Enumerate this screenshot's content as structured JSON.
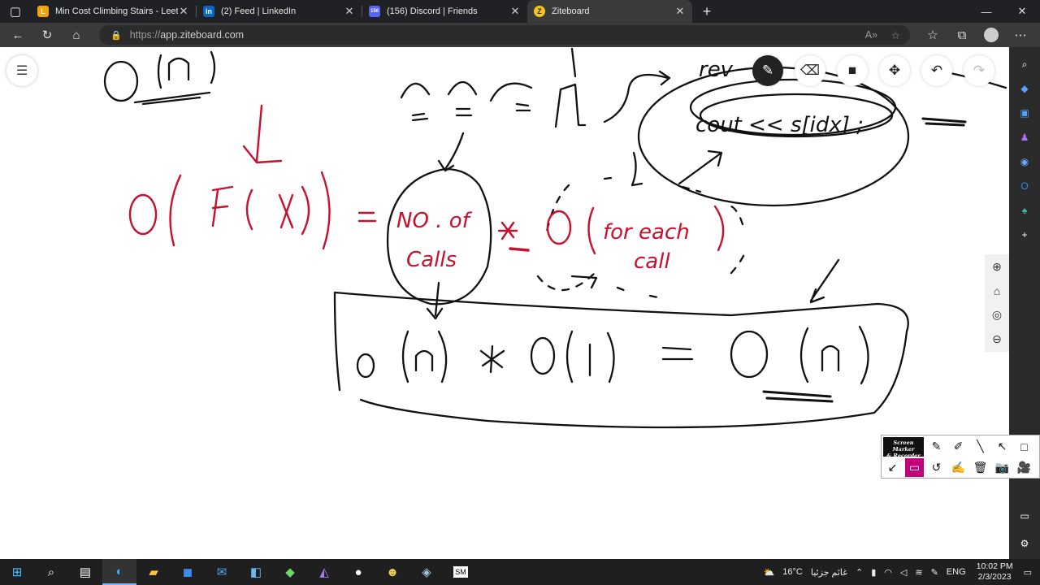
{
  "browser": {
    "tabs": [
      {
        "label": "Min Cost Climbing Stairs - LeetCo",
        "favicon": "leetcode-icon",
        "color": "#f0a30a",
        "glyph": "L"
      },
      {
        "label": "(2) Feed | LinkedIn",
        "favicon": "linkedin-icon",
        "color": "#0a66c2",
        "glyph": "in"
      },
      {
        "label": "(156) Discord | Friends",
        "favicon": "discord-icon",
        "color": "#5865f2",
        "glyph": "156"
      },
      {
        "label": "Ziteboard",
        "favicon": "ziteboard-icon",
        "color": "#f5c518",
        "glyph": "Z",
        "active": true
      }
    ],
    "new_tab": "+",
    "url_protocol": "https://",
    "url_host": "app.ziteboard.com"
  },
  "board": {
    "tools": [
      "pencil-icon",
      "eraser-icon",
      "sticky-note-icon",
      "move-icon",
      "undo-icon",
      "redo-icon"
    ],
    "zoom_controls": [
      "zoom-in-icon",
      "home-icon",
      "center-icon",
      "zoom-out-icon"
    ],
    "handwriting": {
      "top_left": "O(n)",
      "top_row": "⌐ = ⌐ = []",
      "bubble_top": "rev(s, idx) ; cout << s[idx] ; }",
      "formula_left": "O( F( X))",
      "equals": "=",
      "no_of_calls": "NO. of Calls",
      "times": "*",
      "per_call": "O( for each call)",
      "result_line": "O(n) * O(1) = O(n)"
    }
  },
  "screen_marker": {
    "logo_line1": "Screen Marker",
    "logo_line2": "& Recorder",
    "row1": [
      "pencil-icon",
      "marker-icon",
      "line-icon",
      "arrow-icon",
      "rectangle-icon"
    ],
    "row2": [
      "pointer-icon",
      "monitor-icon",
      "history-icon",
      "highlighter-icon",
      "trash-icon",
      "camera-icon",
      "video-icon"
    ]
  },
  "taskbar": {
    "weather_temp": "16°C",
    "weather_text": "غائم جزئيا",
    "lang": "ENG",
    "time": "10:02 PM",
    "date": "2/3/2023"
  },
  "colors": {
    "ink_black": "#111111",
    "ink_red": "#c8102e",
    "accent_marker": "#c2007a"
  }
}
